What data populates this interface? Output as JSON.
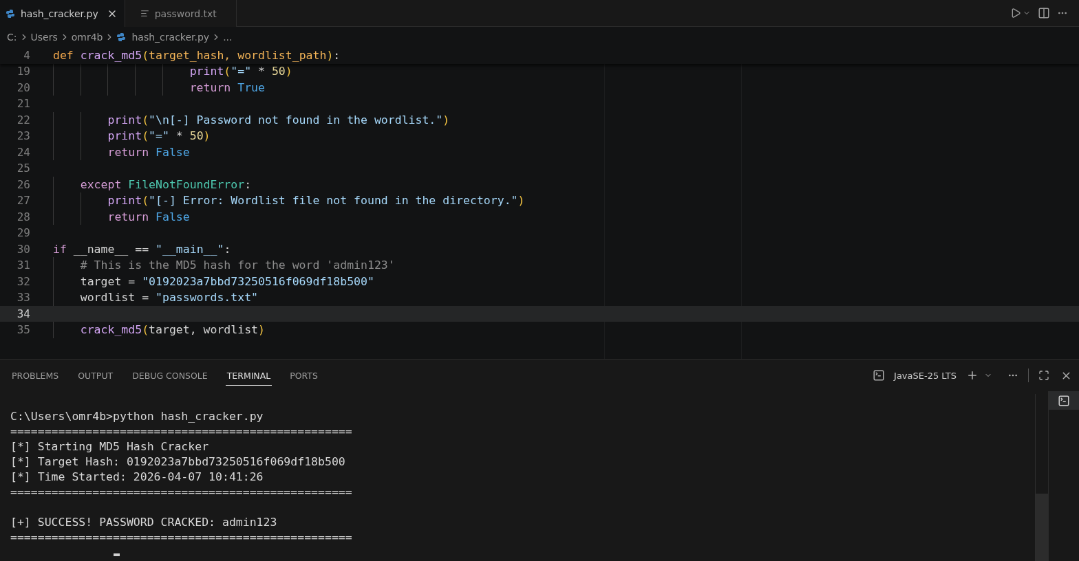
{
  "tabs": [
    {
      "label": "hash_cracker.py",
      "kind": "python",
      "selected": true
    },
    {
      "label": "password.txt",
      "kind": "text",
      "selected": false
    }
  ],
  "breadcrumb": [
    {
      "label": "C:",
      "kind": "folder"
    },
    {
      "label": "Users",
      "kind": "folder"
    },
    {
      "label": "omr4b",
      "kind": "folder"
    },
    {
      "label": "hash_cracker.py",
      "kind": "python"
    },
    {
      "label": "...",
      "kind": "more"
    }
  ],
  "editor": {
    "sticky": {
      "number": "4",
      "tokens": [
        {
          "t": "def ",
          "kind": "storage"
        },
        {
          "t": "crack_md5",
          "kind": "function"
        },
        {
          "t": "(",
          "kind": "bracket"
        },
        {
          "t": "target_hash, wordlist_path",
          "kind": "param"
        },
        {
          "t": ")",
          "kind": "bracket"
        },
        {
          "t": ":",
          "kind": "plain"
        }
      ]
    },
    "lines": [
      {
        "number": "19",
        "current": false,
        "tokens": [
          {
            "t": "                    print",
            "kind": "builtin"
          },
          {
            "t": "(",
            "kind": "bracket"
          },
          {
            "t": "\"=\"",
            "kind": "string"
          },
          {
            "t": " * ",
            "kind": "plain"
          },
          {
            "t": "50",
            "kind": "number"
          },
          {
            "t": ")",
            "kind": "bracket"
          }
        ]
      },
      {
        "number": "20",
        "current": false,
        "tokens": [
          {
            "t": "                    return ",
            "kind": "control"
          },
          {
            "t": "True",
            "kind": "constant"
          }
        ]
      },
      {
        "number": "21",
        "current": false
      },
      {
        "number": "22",
        "current": false,
        "tokens": [
          {
            "t": "        print",
            "kind": "builtin"
          },
          {
            "t": "(",
            "kind": "bracket"
          },
          {
            "t": "\"\\n[-] Password not found in the wordlist.\"",
            "kind": "string"
          },
          {
            "t": ")",
            "kind": "bracket"
          }
        ]
      },
      {
        "number": "23",
        "current": false,
        "tokens": [
          {
            "t": "        print",
            "kind": "builtin"
          },
          {
            "t": "(",
            "kind": "bracket"
          },
          {
            "t": "\"=\"",
            "kind": "string"
          },
          {
            "t": " * ",
            "kind": "plain"
          },
          {
            "t": "50",
            "kind": "number"
          },
          {
            "t": ")",
            "kind": "bracket"
          }
        ]
      },
      {
        "number": "24",
        "current": false,
        "tokens": [
          {
            "t": "        return ",
            "kind": "control"
          },
          {
            "t": "False",
            "kind": "constant"
          }
        ]
      },
      {
        "number": "25",
        "current": false
      },
      {
        "number": "26",
        "current": false,
        "tokens": [
          {
            "t": "    except ",
            "kind": "control"
          },
          {
            "t": "FileNotFoundError",
            "kind": "class"
          },
          {
            "t": ":",
            "kind": "plain"
          }
        ]
      },
      {
        "number": "27",
        "current": false,
        "tokens": [
          {
            "t": "        print",
            "kind": "builtin"
          },
          {
            "t": "(",
            "kind": "bracket"
          },
          {
            "t": "\"[-] Error: Wordlist file not found in the directory.\"",
            "kind": "string"
          },
          {
            "t": ")",
            "kind": "bracket"
          }
        ]
      },
      {
        "number": "28",
        "current": false,
        "tokens": [
          {
            "t": "        return ",
            "kind": "control"
          },
          {
            "t": "False",
            "kind": "constant"
          }
        ]
      },
      {
        "number": "29",
        "current": false
      },
      {
        "number": "30",
        "current": false,
        "tokens": [
          {
            "t": "if ",
            "kind": "control"
          },
          {
            "t": "__name__ == ",
            "kind": "plain"
          },
          {
            "t": "\"__main__\"",
            "kind": "string"
          },
          {
            "t": ":",
            "kind": "plain"
          }
        ]
      },
      {
        "number": "31",
        "current": false,
        "tokens": [
          {
            "t": "    # This is the MD5 hash for the word 'admin123'",
            "kind": "comment"
          }
        ]
      },
      {
        "number": "32",
        "current": false,
        "tokens": [
          {
            "t": "    target = ",
            "kind": "plain"
          },
          {
            "t": "\"0192023a7bbd73250516f069df18b500\"",
            "kind": "string"
          }
        ]
      },
      {
        "number": "33",
        "current": false,
        "tokens": [
          {
            "t": "    wordlist = ",
            "kind": "plain"
          },
          {
            "t": "\"passwords.txt\"",
            "kind": "string"
          }
        ]
      },
      {
        "number": "34",
        "current": true
      },
      {
        "number": "35",
        "current": false,
        "tokens": [
          {
            "t": "    crack_md5",
            "kind": "function"
          },
          {
            "t": "(",
            "kind": "bracket"
          },
          {
            "t": "target, wordlist",
            "kind": "plain"
          },
          {
            "t": ")",
            "kind": "bracket"
          }
        ]
      }
    ]
  },
  "panel": {
    "tabs": [
      {
        "label": "PROBLEMS",
        "selected": false
      },
      {
        "label": "OUTPUT",
        "selected": false
      },
      {
        "label": "DEBUG CONSOLE",
        "selected": false
      },
      {
        "label": "TERMINAL",
        "selected": true
      },
      {
        "label": "PORTS",
        "selected": false
      }
    ],
    "terminal_profile": "JavaSE-25 LTS",
    "terminal_blocks": [
      [
        "C:\\Users\\omr4b>python hash_cracker.py",
        "==================================================",
        "[*] Starting MD5 Hash Cracker",
        "[*] Target Hash: 0192023a7bbd73250516f069df18b500",
        "[*] Time Started: 2026-04-07 10:41:26",
        "=================================================="
      ],
      [
        "[+] SUCCESS! PASSWORD CRACKED: admin123",
        "=================================================="
      ]
    ]
  }
}
